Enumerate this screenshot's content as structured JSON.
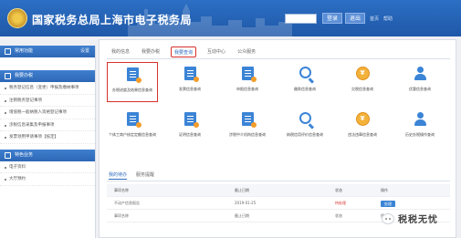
{
  "header": {
    "title": "国家税务总局上海市电子税务局",
    "btn_a": "登录",
    "btn_b": "退出",
    "links": [
      "首页",
      "帮助"
    ]
  },
  "sidebar": {
    "head1": "常用功能",
    "head1_right": "设置",
    "section1": "我要办税",
    "items1": [
      "税务登记信息（变更）申报及缴纳事项",
      "注销税务登记事项",
      "增值税一般纳税人资格登记事项",
      "涉税信息采集及申报事项",
      "发票领用申请事项【核定】"
    ],
    "section2": "特色业务",
    "items2": [
      "电子资料",
      "大厅预约"
    ]
  },
  "main": {
    "tabs": [
      "我的信息",
      "我要办税",
      "我要查询",
      "互动中心",
      "公众服务"
    ],
    "active_tab_index": 2,
    "grid_items": [
      {
        "label": "办税进度及结果信息查询",
        "icon": "document-icon",
        "highlighted": true
      },
      {
        "label": "发票信息查询",
        "icon": "invoice-icon"
      },
      {
        "label": "申报信息查询",
        "icon": "declaration-icon"
      },
      {
        "label": "缴款信息查询",
        "icon": "magnifier-icon"
      },
      {
        "label": "欠税信息查询",
        "icon": "coin-icon"
      },
      {
        "label": "优惠信息查询",
        "icon": "person-icon"
      },
      {
        "label": "个体工商户核定定额信息查询",
        "icon": "document-icon"
      },
      {
        "label": "证明信息查询",
        "icon": "certificate-icon"
      },
      {
        "label": "涉税中介机构信息查询",
        "icon": "agency-icon"
      },
      {
        "label": "纳税信用评价信息查询",
        "icon": "magnifier-icon"
      },
      {
        "label": "违法违章信息查询",
        "icon": "coin-icon"
      },
      {
        "label": "历史办税操作查询",
        "icon": "person-icon"
      }
    ],
    "lower_tabs": [
      "我的待办",
      "服务提醒"
    ],
    "table": {
      "headers": [
        "事项名称",
        "截止日期",
        "状态",
        "操作"
      ],
      "rows": [
        {
          "name": "不动产信息报告",
          "date": "2019-01-25",
          "status": "待处理",
          "action": "处理"
        },
        {
          "name": "事项名称",
          "date": "截止日期",
          "status": "状态",
          "action": "操作"
        }
      ]
    }
  },
  "watermark": {
    "text": "税税无忧"
  },
  "colors": {
    "primary": "#2e6bbd",
    "highlight": "#d6312c",
    "accent": "#f3b23a"
  }
}
